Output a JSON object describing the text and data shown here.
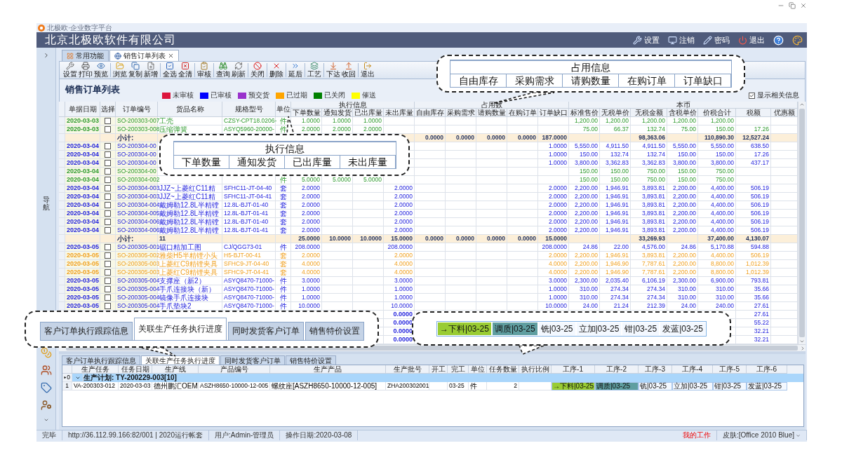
{
  "app_title": "北极欧·企业数字平台",
  "header": {
    "company": "北京北极欧软件有限公司",
    "menu": [
      {
        "label": "设置"
      },
      {
        "label": "注销"
      },
      {
        "label": "密码"
      },
      {
        "label": "退出"
      }
    ]
  },
  "sidebar": {
    "label": "导航"
  },
  "tabs": [
    {
      "label": "常用功能",
      "selected": false,
      "closable": false
    },
    {
      "label": "销售订单列表",
      "selected": true,
      "closable": true
    }
  ],
  "toolbar": [
    [
      {
        "label": "设置"
      },
      {
        "label": "打印"
      },
      {
        "label": "预览"
      }
    ],
    [
      {
        "label": "浏览"
      },
      {
        "label": "复制"
      },
      {
        "label": "新增"
      }
    ],
    [
      {
        "label": "全选"
      },
      {
        "label": "全清"
      }
    ],
    [
      {
        "label": "审核"
      }
    ],
    [
      {
        "label": "查询"
      },
      {
        "label": "刷新"
      }
    ],
    [
      {
        "label": "关闭"
      }
    ],
    [
      {
        "label": "删除"
      }
    ],
    [
      {
        "label": "延后"
      }
    ],
    [
      {
        "label": "工艺"
      }
    ],
    [
      {
        "label": "下达"
      },
      {
        "label": "收回"
      }
    ],
    [
      {
        "label": "退出"
      }
    ]
  ],
  "panel": {
    "title": "销售订单列表",
    "legend": [
      {
        "label": "未审核",
        "color": "#dc143c"
      },
      {
        "label": "已审核",
        "color": "#0000ff"
      },
      {
        "label": "预交货",
        "color": "#9932cc"
      },
      {
        "label": "已过期",
        "color": "#ffa500"
      },
      {
        "label": "已关闭",
        "color": "#008000"
      },
      {
        "label": "催送",
        "color": "#ffff00"
      }
    ],
    "show_related": {
      "label": "显示相关信息",
      "checked": true
    }
  },
  "table": {
    "header": [
      {
        "label": "单据日期"
      },
      {
        "label": "选择"
      },
      {
        "label": "订单编号"
      },
      {
        "label": "货品名称"
      },
      {
        "label": "规格型号"
      },
      {
        "label": "单位"
      },
      {
        "label": "执行信息",
        "columns": [
          "下单数量",
          "通知发货",
          "已出库量",
          "未出库量"
        ]
      },
      {
        "label": "占用数",
        "columns": [
          "自由库存",
          "采购需求",
          "请购数量",
          "在购订单",
          "订单缺口"
        ]
      },
      {
        "label": "本币",
        "columns": [
          "标准售价",
          "无税单价",
          "无税金额",
          "含税单价",
          "价税合计",
          "税额",
          "优惠额"
        ]
      }
    ],
    "rows": [
      {
        "kind": "item",
        "color": "#2e9a2e",
        "checked": false,
        "cells": [
          "2020-03-03",
          "SO-200303-007",
          "工壳",
          "CZSY-CPT18.0206-",
          "件",
          "1.0000",
          "1.0000",
          "1.0000",
          null,
          null,
          null,
          null,
          null,
          null,
          "1,200.00",
          "1,200.00",
          "1,200.00",
          "1,200.00",
          "1,200.00"
        ]
      },
      {
        "kind": "item",
        "color": "#2e9a2e",
        "checked": false,
        "cells": [
          "2020-03-03",
          "SO-200303-008",
          "压缩弹簧",
          "ASYQ5960-20000-",
          "件",
          "2.0000",
          "2.0000",
          "2.0000",
          null,
          null,
          null,
          null,
          null,
          null,
          "75.00",
          "66.37",
          "132.74",
          "75.00",
          "150.00",
          "17.26"
        ]
      },
      {
        "kind": "subtotal",
        "cells": [
          null,
          "小计:",
          null,
          null,
          null,
          null,
          null,
          null,
          null,
          "0.0000",
          "0.0000",
          "0.0000",
          "0.0000",
          "187.0000",
          null,
          null,
          "98,363.06",
          null,
          "110,890.30",
          "12,527.24"
        ]
      },
      {
        "kind": "item",
        "color": "#2222dd",
        "checked": false,
        "cells": [
          "2020-03-04",
          "SO-200304-00",
          null,
          null,
          null,
          null,
          null,
          null,
          null,
          null,
          null,
          null,
          null,
          "1.0000",
          "5,550.00",
          "4,911.50",
          "4,911.50",
          "5,550.00",
          "5,550.00",
          "638.50"
        ]
      },
      {
        "kind": "item",
        "color": "#2222dd",
        "checked": false,
        "cells": [
          "2020-03-04",
          "SO-200304-00",
          null,
          null,
          null,
          null,
          null,
          null,
          null,
          null,
          null,
          null,
          null,
          "1.0000",
          "150.00",
          "132.74",
          "132.74",
          "150.00",
          "150.00",
          "17.26"
        ]
      },
      {
        "kind": "item",
        "color": "#2222dd",
        "checked": false,
        "cells": [
          "2020-03-04",
          "SO-200304-00",
          null,
          null,
          null,
          null,
          null,
          null,
          null,
          null,
          null,
          null,
          null,
          "1.0000",
          "3,800.00",
          "3,362.83",
          "3,362.83",
          "3,800.00",
          "3,800.00",
          "437.17"
        ]
      },
      {
        "kind": "item",
        "color": "#2e9a2e",
        "checked": false,
        "cells": [
          "2020-03-04",
          "SO-200304-00",
          null,
          null,
          null,
          null,
          null,
          null,
          null,
          null,
          null,
          null,
          null,
          null,
          "150.00",
          "150.00",
          "750.00",
          "150.00",
          "750.00"
        ]
      },
      {
        "kind": "item",
        "color": "#2e9a2e",
        "checked": false,
        "cells": [
          "2020-03-04",
          "SO-200304-002",
          null,
          null,
          "件",
          "5.0000",
          "5.0000",
          "5.0000",
          null,
          null,
          null,
          null,
          null,
          null,
          "150.00",
          "150.00",
          "750.00",
          "150.00",
          "750.00"
        ]
      },
      {
        "kind": "item",
        "color": "#2222dd",
        "checked": false,
        "cells": [
          "2020-03-04",
          "SO-200304-003",
          "JJZ~上菱红C11精",
          "SFHC11-JT-04-40",
          "套",
          "2.0000",
          null,
          null,
          "2.0000",
          null,
          null,
          null,
          null,
          "2.0000",
          "2,200.00",
          "1,946.91",
          "3,893.81",
          "2,200.00",
          "4,400.00",
          "506.19"
        ]
      },
      {
        "kind": "item",
        "color": "#2222dd",
        "checked": false,
        "cells": [
          "2020-03-04",
          "SO-200304-003",
          "JJZ~上菱红C11精",
          "SFHC11-JT-04-41",
          "套",
          "2.0000",
          null,
          null,
          "2.0000",
          null,
          null,
          null,
          null,
          "2.0000",
          "2,200.00",
          "1,946.91",
          "3,893.81",
          "2,200.00",
          "4,400.00",
          "506.19"
        ]
      },
      {
        "kind": "item",
        "color": "#2222dd",
        "checked": false,
        "cells": [
          "2020-03-04",
          "SO-200304-004",
          "戴姆勒12.8L半精镗",
          "12.8L-BJT-01-40",
          "套",
          "2.0000",
          null,
          null,
          "2.0000",
          null,
          null,
          null,
          null,
          "2.0000",
          "2,200.00",
          "1,946.91",
          "3,893.81",
          "2,200.00",
          "4,400.00",
          "506.19"
        ]
      },
      {
        "kind": "item",
        "color": "#2222dd",
        "checked": false,
        "cells": [
          "2020-03-04",
          "SO-200304-005",
          "戴姆勒12.8L半精镗",
          "12.8L-BJT-01-41",
          "套",
          "2.0000",
          null,
          null,
          "2.0000",
          null,
          null,
          null,
          null,
          "2.0000",
          "2,200.00",
          "1,946.91",
          "3,893.81",
          "2,200.00",
          "4,400.00",
          "506.19"
        ]
      },
      {
        "kind": "item",
        "color": "#2222dd",
        "checked": false,
        "cells": [
          "2020-03-04",
          "SO-200304-006",
          "戴姆勒12.8L半精镗",
          "12.8L-BJT-01-40",
          "套",
          "2.0000",
          null,
          null,
          "2.0000",
          null,
          null,
          null,
          null,
          "2.0000",
          "2,200.00",
          "1,946.91",
          "3,893.81",
          "2,200.00",
          "4,400.00",
          "506.19"
        ]
      },
      {
        "kind": "item",
        "color": "#2222dd",
        "checked": false,
        "cells": [
          "2020-03-04",
          "SO-200304-006",
          "戴姆勒12.8L半精镗",
          "12.8L-BJT-01-41",
          "套",
          "2.0000",
          null,
          null,
          "2.0000",
          null,
          null,
          null,
          null,
          "2.0000",
          "2,200.00",
          "1,946.91",
          "3,893.81",
          "2,200.00",
          "4,400.00",
          "506.19"
        ]
      },
      {
        "kind": "subtotal",
        "cells": [
          null,
          "小计:",
          "11",
          null,
          null,
          "25.0000",
          "10.0000",
          "10.0000",
          "15.0000",
          "0.0000",
          "0.0000",
          "0.0000",
          "0.0000",
          "15.0000",
          null,
          null,
          "33,269.93",
          null,
          "37,400.00",
          "4,130.07"
        ]
      },
      {
        "kind": "item",
        "color": "#2222dd",
        "checked": false,
        "cells": [
          "2020-03-05",
          "SO-200305-001",
          "锯口精加工图",
          "CJ/QGG73-01",
          "件",
          "208.0000",
          null,
          null,
          "208.0000",
          null,
          null,
          null,
          null,
          "208.0000",
          "24.86",
          "22.00",
          "4,576.00",
          "24.86",
          "5,170.88",
          "594.88"
        ]
      },
      {
        "kind": "item",
        "color": "#f0a020",
        "checked": false,
        "cells": [
          "2020-03-05",
          "SO-200305-002",
          "雅柴H5半精镗小头",
          "H5-BJT-00-41",
          "套",
          "2.0000",
          null,
          null,
          "2.0000",
          null,
          null,
          null,
          null,
          "2.0000",
          "2,200.00",
          "1,946.91",
          "3,893.81",
          "2,200.00",
          "4,400.00",
          "506.19"
        ]
      },
      {
        "kind": "item",
        "color": "#f0a020",
        "checked": false,
        "cells": [
          "2020-03-05",
          "SO-200305-003",
          "上菱红C9精镗夹具",
          "SFHC9-JT-04-40",
          "套",
          "4.0000",
          null,
          null,
          "4.0000",
          null,
          null,
          null,
          null,
          "4.0000",
          "2,200.00",
          "1,946.90",
          "7,787.61",
          "2,200.00",
          "8,800.00",
          "1,012.39"
        ]
      },
      {
        "kind": "item",
        "color": "#f0a020",
        "checked": false,
        "cells": [
          "2020-03-05",
          "SO-200305-003",
          "上菱红C9精镗夹具",
          "SFHC9-JT-04-41",
          "套",
          "4.0000",
          null,
          null,
          "4.0000",
          null,
          null,
          null,
          null,
          "4.0000",
          "2,200.00",
          "1,946.90",
          "7,787.61",
          "2,200.00",
          "8,800.00",
          "1,012.39"
        ]
      },
      {
        "kind": "item",
        "color": "#2222dd",
        "checked": false,
        "cells": [
          "2020-03-05",
          "SO-200305-004",
          "支撑座（新2）",
          "ASYQ8470-71000-",
          "件",
          "3.0000",
          null,
          null,
          "3.0000",
          null,
          null,
          null,
          null,
          "3.0000",
          "2,300.00",
          "2,035.40",
          "6,106.19",
          "2,300.00",
          "6,900.00",
          "793.81"
        ]
      },
      {
        "kind": "item",
        "color": "#2222dd",
        "checked": false,
        "cells": [
          "2020-03-05",
          "SO-200305-004",
          "手爪连接块（新）",
          "ASYQ8470-71000-",
          "件",
          "1.0000",
          null,
          null,
          "1.0000",
          null,
          null,
          null,
          null,
          "1.0000",
          "310.00",
          "274.34",
          "274.34",
          "310.00",
          "310.00",
          "35.66"
        ]
      },
      {
        "kind": "item",
        "color": "#2222dd",
        "checked": false,
        "cells": [
          "2020-03-05",
          "SO-200305-004",
          "镜像手爪连接块",
          "ASYQ8470-71000-",
          "件",
          "1.0000",
          null,
          null,
          "1.0000",
          null,
          null,
          null,
          null,
          "1.0000",
          "310.00",
          "274.34",
          "274.34",
          "310.00",
          "310.00",
          "35.66"
        ]
      },
      {
        "kind": "item",
        "color": "#2222dd",
        "checked": false,
        "cells": [
          "2020-03-05",
          "SO-200305-004",
          "手爪垫块2",
          "ASYQ8470-71000-",
          "件",
          "10.0000",
          null,
          null,
          "10.0000",
          null,
          null,
          null,
          null,
          "10.0000",
          "24.00",
          "21.24",
          "212.39",
          "24.00",
          "240.00",
          "27.61"
        ]
      },
      {
        "kind": "item",
        "color": "#2222dd",
        "cells": [
          null,
          null,
          null,
          null,
          null,
          null,
          null,
          null,
          "0.0000",
          null,
          null,
          null,
          null,
          null,
          null,
          null,
          null,
          null,
          null,
          "27.61"
        ]
      },
      {
        "kind": "item",
        "color": "#2222dd",
        "cells": [
          null,
          null,
          null,
          null,
          null,
          null,
          null,
          null,
          "0.0000",
          null,
          null,
          null,
          null,
          null,
          null,
          null,
          null,
          null,
          null,
          "55.22"
        ]
      },
      {
        "kind": "item",
        "color": "#2222dd",
        "cells": [
          null,
          null,
          null,
          null,
          null,
          null,
          null,
          null,
          "0.0000",
          null,
          null,
          null,
          null,
          null,
          null,
          null,
          null,
          null,
          null,
          "32.21"
        ]
      },
      {
        "kind": "item",
        "color": "#2222dd",
        "cells": [
          null,
          null,
          null,
          null,
          null,
          null,
          null,
          null,
          "0.0000",
          null,
          null,
          null,
          null,
          null,
          null,
          null,
          null,
          null,
          null,
          "32.21"
        ]
      }
    ]
  },
  "bottom_panel": {
    "tabs": [
      {
        "label": "客户订单执行跟踪信息",
        "selected": false
      },
      {
        "label": "关联生产任务执行进度",
        "selected": true
      },
      {
        "label": "同时发货客户订单",
        "selected": false
      },
      {
        "label": "销售特价设置",
        "selected": false
      }
    ],
    "columns": [
      "生产任务",
      "任务日期",
      "生产线",
      "产品编号",
      "生产产品",
      "生产批号",
      "开工",
      "完工",
      "单位",
      "任务数量",
      "执行比例",
      "工序-1",
      "工序-2",
      "工序-3",
      "工序-4",
      "工序-5",
      "工序-6"
    ],
    "group": {
      "index": "0",
      "label": "生产计划: TY-200229-003[10]",
      "expanded": true
    },
    "rows": [
      {
        "index": "1",
        "cells": [
          "VA-200303-012",
          "2020-03-03",
          "德州鹏汇OEM",
          "ASZH8650-10000-12-005",
          "螺纹座[ASZH8650-10000-12-005]",
          "ZHA200302001",
          null,
          "03-25",
          "件",
          "2",
          null
        ],
        "processes": [
          {
            "text": "→下料|03-25",
            "color": "#99cc33"
          },
          {
            "text": "调质|03-25",
            "color": "#5f9ea0"
          },
          {
            "text": "铣|03-25",
            "color": "#f3f8ff"
          },
          {
            "text": "立加|03-25",
            "color": "#f3f8ff"
          },
          {
            "text": "钳|03-25",
            "color": "#f3f8ff"
          },
          {
            "text": "发蓝|03-25",
            "color": "#f3f8ff"
          }
        ]
      }
    ]
  },
  "status_bar": {
    "left": [
      "完毕",
      "http://36.112.99.166:82/001 | 2020运行帐套",
      "用户:Admin-管理员",
      "操作日期:2020-03-08"
    ],
    "right": [
      {
        "kind": "alert",
        "text": "我的工作"
      },
      {
        "kind": "dropdown",
        "text": "皮肤:[Office 2010 Blue]"
      }
    ]
  },
  "callouts": [
    {
      "kind": "table",
      "title": "占用信息",
      "columns": [
        "自由库存",
        "采购需求",
        "请购数量",
        "在购订单",
        "订单缺口"
      ]
    },
    {
      "kind": "table",
      "title": "执行信息",
      "columns": [
        "下单数量",
        "通知发货",
        "已出库量",
        "未出库量"
      ]
    },
    {
      "kind": "tabs",
      "tabs": [
        {
          "label": "客户订单执行跟踪信息",
          "selected": false
        },
        {
          "label": "关联生产任务执行进度",
          "selected": true
        },
        {
          "label": "同时发货客户订单",
          "selected": false
        },
        {
          "label": "销售特价设置",
          "selected": false
        }
      ]
    },
    {
      "kind": "chips",
      "chips": [
        {
          "text": "→下料|03-25",
          "color": "#99cc33"
        },
        {
          "text": "调质|03-25",
          "color": "#5f9ea0"
        },
        {
          "text": "铣|03-25",
          "color": "#f3f8ff"
        },
        {
          "text": "立加|03-25",
          "color": "#f3f8ff"
        },
        {
          "text": "钳|03-25",
          "color": "#f3f8ff"
        },
        {
          "text": "发蓝|03-25",
          "color": "#f3f8ff"
        }
      ]
    }
  ]
}
